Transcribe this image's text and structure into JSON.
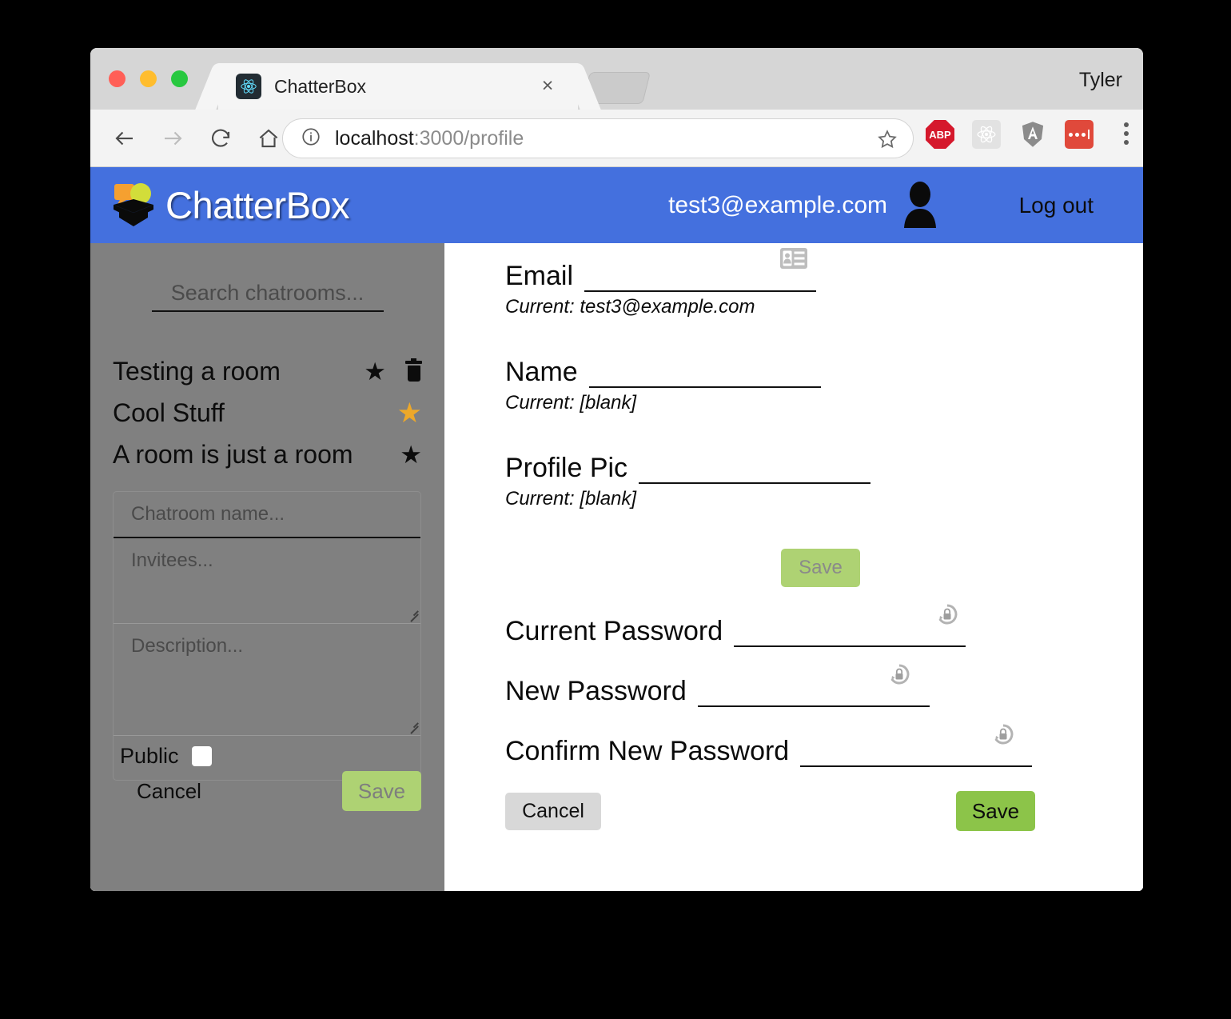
{
  "browser": {
    "tab": {
      "title": "ChatterBox",
      "favicon": "react-icon",
      "close": "×"
    },
    "profile_name": "Tyler",
    "url": {
      "host": "localhost",
      "path": ":3000/profile",
      "info_icon": "info-icon"
    },
    "extensions": [
      {
        "name": "adblock-plus",
        "label": "ABP"
      },
      {
        "name": "react-devtools",
        "label": ""
      },
      {
        "name": "angular-devtools",
        "label": "A"
      },
      {
        "name": "more-extension",
        "label": ""
      }
    ]
  },
  "app": {
    "brand": "ChatterBox",
    "header": {
      "email": "test3@example.com",
      "avatar_icon": "user-avatar-icon",
      "logout_label": "Log out"
    }
  },
  "sidebar": {
    "search_placeholder": "Search chatrooms...",
    "search_value": "",
    "rooms": [
      {
        "name": "Testing a room",
        "starred": false,
        "deletable": true
      },
      {
        "name": "Cool Stuff",
        "starred": true,
        "deletable": false
      },
      {
        "name": "A room is just a room",
        "starred": false,
        "deletable": false
      }
    ],
    "create_form": {
      "name_placeholder": "Chatroom name...",
      "name_value": "",
      "invitees_placeholder": "Invitees...",
      "invitees_value": "",
      "description_placeholder": "Description...",
      "description_value": "",
      "public_label": "Public",
      "public_checked": false,
      "cancel_label": "Cancel",
      "save_label": "Save"
    }
  },
  "profile": {
    "fields": [
      {
        "label": "Email",
        "value": "",
        "current": "Current: test3@example.com",
        "icon": "id-card-icon"
      },
      {
        "label": "Name",
        "value": "",
        "current": "Current: [blank]",
        "icon": ""
      },
      {
        "label": "Profile Pic",
        "value": "",
        "current": "Current: [blank]",
        "icon": ""
      }
    ],
    "save_top_label": "Save",
    "password_fields": [
      {
        "label": "Current Password",
        "value": "",
        "icon": "lock-reset-icon"
      },
      {
        "label": "New Password",
        "value": "",
        "icon": "lock-reset-icon"
      },
      {
        "label": "Confirm New Password",
        "value": "",
        "icon": "lock-reset-icon"
      }
    ],
    "cancel_label": "Cancel",
    "save_label": "Save"
  },
  "colors": {
    "header_blue": "#4470de",
    "sidebar_gray": "#808080",
    "save_active_green": "#8cc449",
    "save_disabled_green": "#aed273",
    "star_gold": "#eda829"
  }
}
